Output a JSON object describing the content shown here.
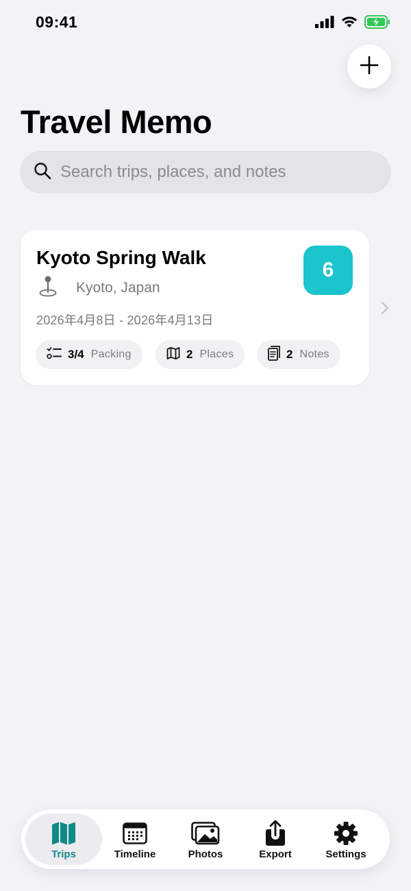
{
  "status_bar": {
    "time": "09:41"
  },
  "header": {
    "title": "Travel Memo",
    "add_icon": "plus-icon"
  },
  "search": {
    "placeholder": "Search trips, places, and notes",
    "value": ""
  },
  "trips": [
    {
      "title": "Kyoto Spring Walk",
      "location": "Kyoto, Japan",
      "dates": "2026年4月8日 - 2026年4月13日",
      "days": "6",
      "stats": {
        "packing_value": "3/4",
        "packing_label": "Packing",
        "places_value": "2",
        "places_label": "Places",
        "notes_value": "2",
        "notes_label": "Notes"
      }
    }
  ],
  "tab_bar": {
    "tabs": [
      {
        "label": "Trips",
        "icon": "map-icon",
        "active": true
      },
      {
        "label": "Timeline",
        "icon": "calendar-icon",
        "active": false
      },
      {
        "label": "Photos",
        "icon": "photos-icon",
        "active": false
      },
      {
        "label": "Export",
        "icon": "share-icon",
        "active": false
      },
      {
        "label": "Settings",
        "icon": "gear-icon",
        "active": false
      }
    ]
  },
  "colors": {
    "accent": "#1cc4cd",
    "active_tab_label": "#138a8a",
    "background": "#f2f2f7",
    "battery": "#34c759"
  }
}
